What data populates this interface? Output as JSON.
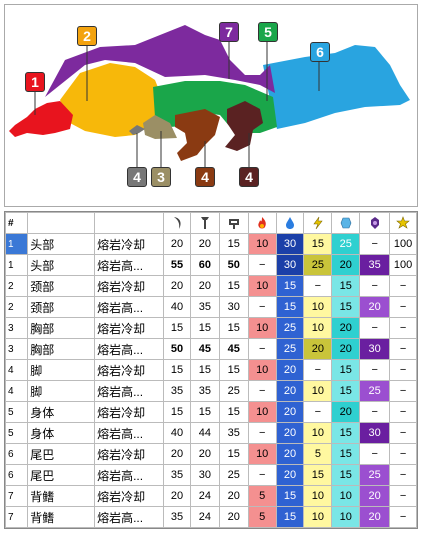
{
  "diagram": {
    "labels": [
      {
        "text": "1",
        "color": "#e8141e"
      },
      {
        "text": "2",
        "color": "#f3a30f"
      },
      {
        "text": "7",
        "color": "#7d2a9e"
      },
      {
        "text": "5",
        "color": "#1aa64a"
      },
      {
        "text": "6",
        "color": "#29a4e0"
      },
      {
        "text": "4",
        "color": "#777777"
      },
      {
        "text": "3",
        "color": "#9b8f65"
      },
      {
        "text": "4",
        "color": "#8a3a12"
      },
      {
        "text": "4",
        "color": "#5a2222"
      }
    ]
  },
  "table": {
    "headers": [
      "#",
      "",
      "",
      "slash-icon",
      "pierce-icon",
      "crush-icon",
      "fire-icon",
      "water-icon",
      "thunder-icon",
      "ice-icon",
      "dragon-icon",
      "stun-icon"
    ],
    "colors": {
      "fire": "#f49090",
      "water_dark": "#1b3fa8",
      "water_mid": "#2f62d2",
      "water_light": "#6f95e8",
      "thunder_light": "#fff8a0",
      "thunder_dark": "#c9c43a",
      "ice": "#2fd0d0",
      "ice_light": "#7ae6e6",
      "dragon_dark": "#6a1fa0",
      "dragon_mid": "#9b4fd0",
      "dragon_light": "#c79ae8",
      "selected": "#3a78d6"
    },
    "rows": [
      {
        "idx": "1",
        "part": "头部",
        "state": "熔岩冷却",
        "slash": "20",
        "pierce": "20",
        "crush": "15",
        "fire": "10",
        "water": "30",
        "thunder": "15",
        "ice": "25",
        "dragon": "−",
        "stun": "100",
        "bold": false,
        "selected": true
      },
      {
        "idx": "1",
        "part": "头部",
        "state": "熔岩高...",
        "slash": "55",
        "pierce": "60",
        "crush": "50",
        "fire": "−",
        "water": "30",
        "thunder": "25",
        "ice": "20",
        "dragon": "35",
        "stun": "100",
        "bold": true,
        "selected": false
      },
      {
        "idx": "2",
        "part": "颈部",
        "state": "熔岩冷却",
        "slash": "20",
        "pierce": "20",
        "crush": "15",
        "fire": "10",
        "water": "15",
        "thunder": "−",
        "ice": "15",
        "dragon": "−",
        "stun": "−",
        "bold": false,
        "selected": false
      },
      {
        "idx": "2",
        "part": "颈部",
        "state": "熔岩高...",
        "slash": "40",
        "pierce": "35",
        "crush": "30",
        "fire": "−",
        "water": "15",
        "thunder": "10",
        "ice": "15",
        "dragon": "20",
        "stun": "−",
        "bold": false,
        "selected": false
      },
      {
        "idx": "3",
        "part": "胸部",
        "state": "熔岩冷却",
        "slash": "15",
        "pierce": "15",
        "crush": "15",
        "fire": "10",
        "water": "25",
        "thunder": "10",
        "ice": "20",
        "dragon": "−",
        "stun": "−",
        "bold": false,
        "selected": false
      },
      {
        "idx": "3",
        "part": "胸部",
        "state": "熔岩高...",
        "slash": "50",
        "pierce": "45",
        "crush": "45",
        "fire": "−",
        "water": "25",
        "thunder": "20",
        "ice": "20",
        "dragon": "30",
        "stun": "−",
        "bold": true,
        "selected": false
      },
      {
        "idx": "4",
        "part": "脚",
        "state": "熔岩冷却",
        "slash": "15",
        "pierce": "15",
        "crush": "15",
        "fire": "10",
        "water": "20",
        "thunder": "−",
        "ice": "15",
        "dragon": "−",
        "stun": "−",
        "bold": false,
        "selected": false
      },
      {
        "idx": "4",
        "part": "脚",
        "state": "熔岩高...",
        "slash": "35",
        "pierce": "35",
        "crush": "25",
        "fire": "−",
        "water": "20",
        "thunder": "10",
        "ice": "15",
        "dragon": "25",
        "stun": "−",
        "bold": false,
        "selected": false
      },
      {
        "idx": "5",
        "part": "身体",
        "state": "熔岩冷却",
        "slash": "15",
        "pierce": "15",
        "crush": "15",
        "fire": "10",
        "water": "20",
        "thunder": "−",
        "ice": "20",
        "dragon": "−",
        "stun": "−",
        "bold": false,
        "selected": false
      },
      {
        "idx": "5",
        "part": "身体",
        "state": "熔岩高...",
        "slash": "40",
        "pierce": "44",
        "crush": "35",
        "fire": "−",
        "water": "20",
        "thunder": "10",
        "ice": "15",
        "dragon": "30",
        "stun": "−",
        "bold": false,
        "selected": false
      },
      {
        "idx": "6",
        "part": "尾巴",
        "state": "熔岩冷却",
        "slash": "20",
        "pierce": "20",
        "crush": "15",
        "fire": "10",
        "water": "20",
        "thunder": "5",
        "ice": "15",
        "dragon": "−",
        "stun": "−",
        "bold": false,
        "selected": false
      },
      {
        "idx": "6",
        "part": "尾巴",
        "state": "熔岩高...",
        "slash": "35",
        "pierce": "30",
        "crush": "25",
        "fire": "−",
        "water": "20",
        "thunder": "15",
        "ice": "15",
        "dragon": "25",
        "stun": "−",
        "bold": false,
        "selected": false
      },
      {
        "idx": "7",
        "part": "背鳍",
        "state": "熔岩冷却",
        "slash": "20",
        "pierce": "24",
        "crush": "20",
        "fire": "5",
        "water": "15",
        "thunder": "10",
        "ice": "10",
        "dragon": "20",
        "stun": "−",
        "bold": false,
        "selected": false
      },
      {
        "idx": "7",
        "part": "背鳍",
        "state": "熔岩高...",
        "slash": "35",
        "pierce": "24",
        "crush": "20",
        "fire": "5",
        "water": "15",
        "thunder": "10",
        "ice": "10",
        "dragon": "20",
        "stun": "−",
        "bold": false,
        "selected": false
      }
    ]
  }
}
